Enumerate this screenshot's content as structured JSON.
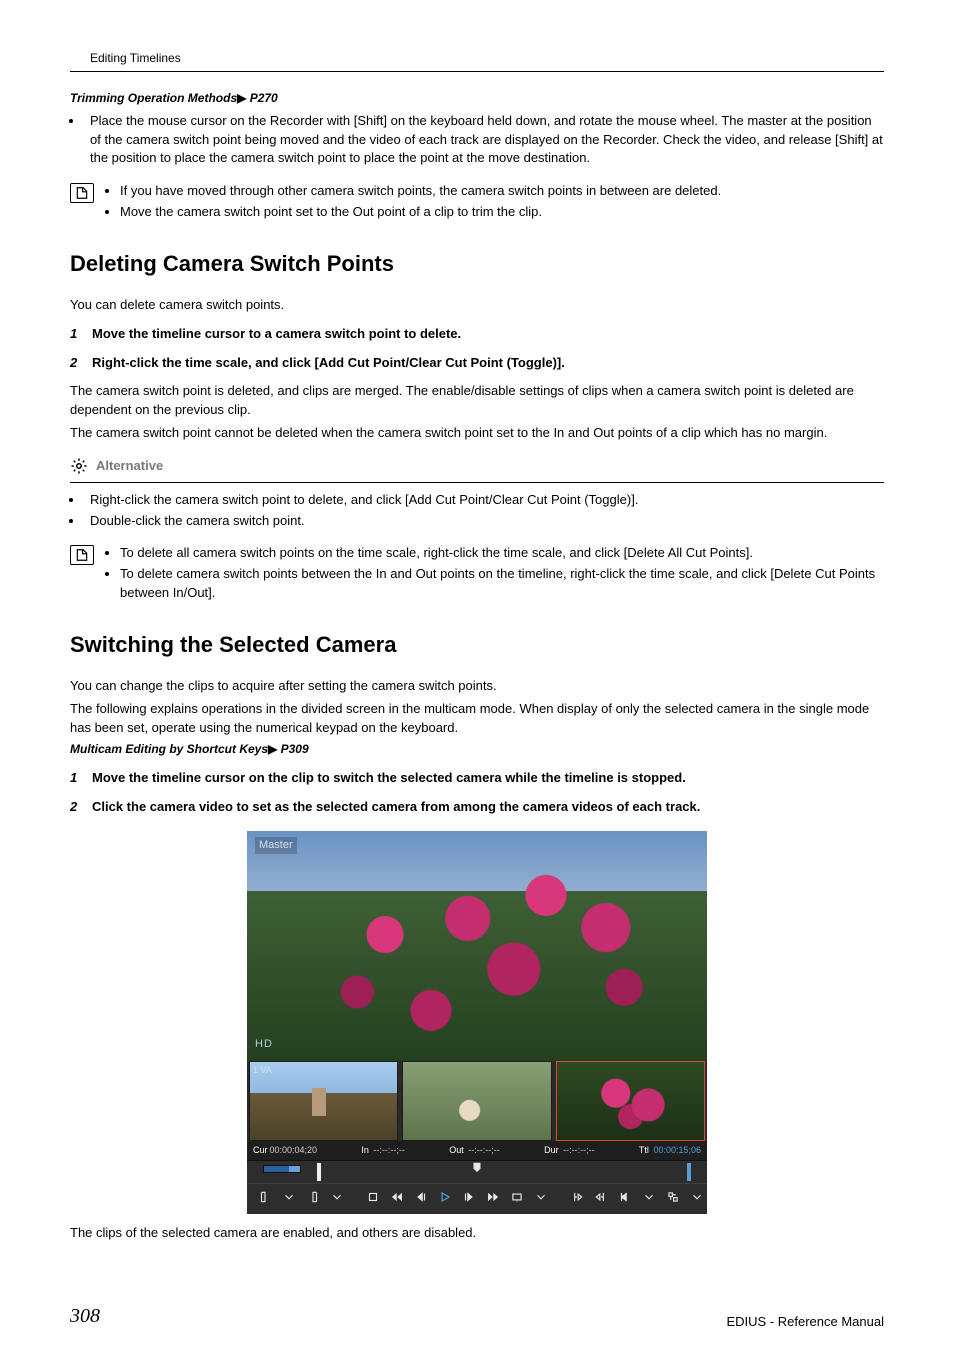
{
  "header": {
    "breadcrumb": "Editing Timelines"
  },
  "crossref1": {
    "text": "Trimming Operation Methods",
    "page": "P270"
  },
  "intro_bullets": [
    "Place the mouse cursor on the Recorder with [Shift] on the keyboard held down, and rotate the mouse wheel. The master at the position of the camera switch point being moved and the video of each track are displayed on the Recorder. Check the video, and release [Shift] at the position to place the camera switch point to place the point at the move destination."
  ],
  "note1": [
    "If you have moved through other camera switch points, the camera switch points in between are deleted.",
    "Move the camera switch point set to the Out point of a clip to trim the clip."
  ],
  "section1": {
    "title": "Deleting Camera Switch Points",
    "lead": "You can delete camera switch points.",
    "steps": [
      "Move the timeline cursor to a camera switch point to delete.",
      "Right-click the time scale, and click [Add Cut Point/Clear Cut Point (Toggle)]."
    ],
    "post1": "The camera switch point is deleted, and clips are merged. The enable/disable settings of clips when a camera switch point is deleted are dependent on the previous clip.",
    "post2": "The camera switch point cannot be deleted when the camera switch point set to the In and Out points of a clip which has no margin.",
    "alt_label": "Alternative",
    "alt_bullets": [
      "Right-click the camera switch point to delete, and click [Add Cut Point/Clear Cut Point (Toggle)].",
      "Double-click the camera switch point."
    ],
    "note2": [
      "To delete all camera switch points on the time scale, right-click the time scale, and click [Delete All Cut Points].",
      "To delete camera switch points between the In and Out points on the timeline, right-click the time scale, and click [Delete Cut Points between In/Out]."
    ]
  },
  "section2": {
    "title": "Switching the Selected Camera",
    "lead1": "You can change the clips to acquire after setting the camera switch points.",
    "lead2": "The following explains operations in the divided screen in the multicam mode. When display of only the selected camera in the single mode has been set, operate using the numerical keypad on the keyboard.",
    "crossref": {
      "text": "Multicam Editing by Shortcut Keys",
      "page": "P309"
    },
    "steps": [
      "Move the timeline cursor on the clip to switch the selected camera while the timeline is stopped.",
      "Click the camera video to set as the selected camera from among the camera videos of each track."
    ],
    "after_fig": "The clips of the selected camera are enabled, and others are disabled."
  },
  "figure": {
    "master": "Master",
    "hd": "HD",
    "thumbs": [
      "1 VA",
      "",
      ""
    ],
    "tc": {
      "cur_l": "Cur",
      "cur_v": "00:00:04;20",
      "in_l": "In",
      "in_v": "--:--:--;--",
      "out_l": "Out",
      "out_v": "--:--:--;--",
      "dur_l": "Dur",
      "dur_v": "--:--:--;--",
      "ttl_l": "Ttl",
      "ttl_v": "00:00:15;06"
    }
  },
  "footer": {
    "page": "308",
    "doc": "EDIUS - Reference Manual"
  }
}
